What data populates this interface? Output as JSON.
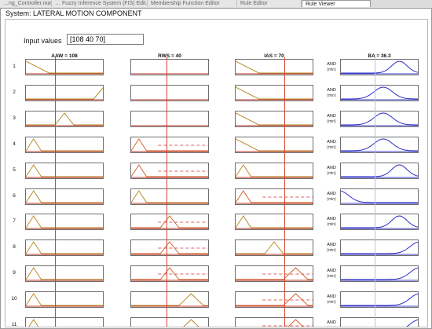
{
  "tabs": [
    {
      "label": "…ng_Controller.mat",
      "active": false
    },
    {
      "label": "… Fuzzy Inference System (FIS) Edit…",
      "active": false
    },
    {
      "label": "Membership Function Editor",
      "active": false
    },
    {
      "label": "Rule Editor",
      "active": false
    },
    {
      "label": "Rule Viewer",
      "active": true
    }
  ],
  "system_title": "System: LATERAL MOTION COMPONENT",
  "input_label": "Input values",
  "input_value": "[108 40 70]",
  "columns": [
    "AAW = 108",
    "RWS = 40",
    "IAS = 70",
    "BA = 36.3"
  ],
  "and_label": "AND",
  "and_sub": "(min)",
  "inputs_range": {
    "AAW": [
      0,
      180
    ],
    "RWS": [
      0,
      180
    ],
    "IAS": [
      0,
      180
    ],
    "BA": [
      0,
      180
    ]
  },
  "rules": [
    {
      "n": "1",
      "AAW": "ramp-down-left",
      "RWS": "none",
      "IAS": "ramp-down-left",
      "BA": "peak-right",
      "fire": [
        false,
        false,
        false
      ]
    },
    {
      "n": "2",
      "AAW": "ramp-up-right",
      "RWS": "none",
      "IAS": "ramp-down-left",
      "BA": "peak-center",
      "fire": [
        false,
        false,
        false
      ]
    },
    {
      "n": "3",
      "AAW": "peak-center",
      "RWS": "none",
      "IAS": "ramp-down-left",
      "BA": "peak-center",
      "fire": [
        false,
        false,
        false
      ]
    },
    {
      "n": "4",
      "AAW": "peak-left",
      "RWS": "peak-left",
      "IAS": "ramp-down-left",
      "BA": "peak-center",
      "fire": [
        false,
        true,
        false
      ]
    },
    {
      "n": "5",
      "AAW": "peak-left",
      "RWS": "peak-left",
      "IAS": "peak-left",
      "BA": "peak-right",
      "fire": [
        false,
        true,
        false
      ]
    },
    {
      "n": "6",
      "AAW": "peak-left",
      "RWS": "peak-left",
      "IAS": "peak-left",
      "BA": "ramp-down-left",
      "fire": [
        false,
        false,
        true
      ]
    },
    {
      "n": "7",
      "AAW": "peak-left",
      "RWS": "peak-center",
      "IAS": "peak-left",
      "BA": "peak-right",
      "fire": [
        false,
        true,
        false
      ]
    },
    {
      "n": "8",
      "AAW": "peak-left",
      "RWS": "peak-center",
      "IAS": "peak-center",
      "BA": "ramp-up-right",
      "fire": [
        false,
        true,
        false
      ]
    },
    {
      "n": "9",
      "AAW": "peak-left",
      "RWS": "peak-center",
      "IAS": "peak-right",
      "BA": "ramp-up-right",
      "fire": [
        false,
        true,
        true
      ]
    },
    {
      "n": "10",
      "AAW": "peak-left",
      "RWS": "peak-right",
      "IAS": "peak-right",
      "BA": "ramp-up-right",
      "fire": [
        false,
        false,
        true
      ]
    },
    {
      "n": "11",
      "AAW": "peak-left",
      "RWS": "peak-right",
      "IAS": "peak-right",
      "BA": "ramp-up-right",
      "fire": [
        false,
        false,
        true
      ]
    }
  ],
  "colors": {
    "input_curve": "#b98a2a",
    "input_curve_firing": "#d2622e",
    "output_curve": "#2c2cc8",
    "output_fill": "#3a3ad0",
    "base_red": "#c0392b",
    "base_blue": "#4444cc",
    "marker_line": "#d2462a",
    "dash": "#e06060"
  }
}
